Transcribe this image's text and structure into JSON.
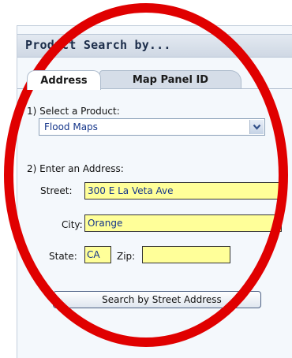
{
  "panel": {
    "title": "Product Search by..."
  },
  "tabs": [
    {
      "label": "Address",
      "active": true
    },
    {
      "label": "Map Panel ID",
      "active": false
    }
  ],
  "product": {
    "label": "1) Select a Product:",
    "selected": "Flood Maps"
  },
  "address": {
    "label": "2) Enter an Address:",
    "street_label": "Street:",
    "street_value": "300 E La Veta Ave",
    "city_label": "City:",
    "city_value": "Orange",
    "state_label": "State:",
    "state_value": "CA",
    "zip_label": "Zip:",
    "zip_value": ""
  },
  "search_button": {
    "label": "Search by Street Address"
  },
  "colors": {
    "input_fill": "#ffff99",
    "annotation_ring": "#e00000",
    "header_text": "#1c2d4a",
    "value_text": "#14358a"
  },
  "icons": {
    "dropdown": "chevron-down-icon"
  }
}
